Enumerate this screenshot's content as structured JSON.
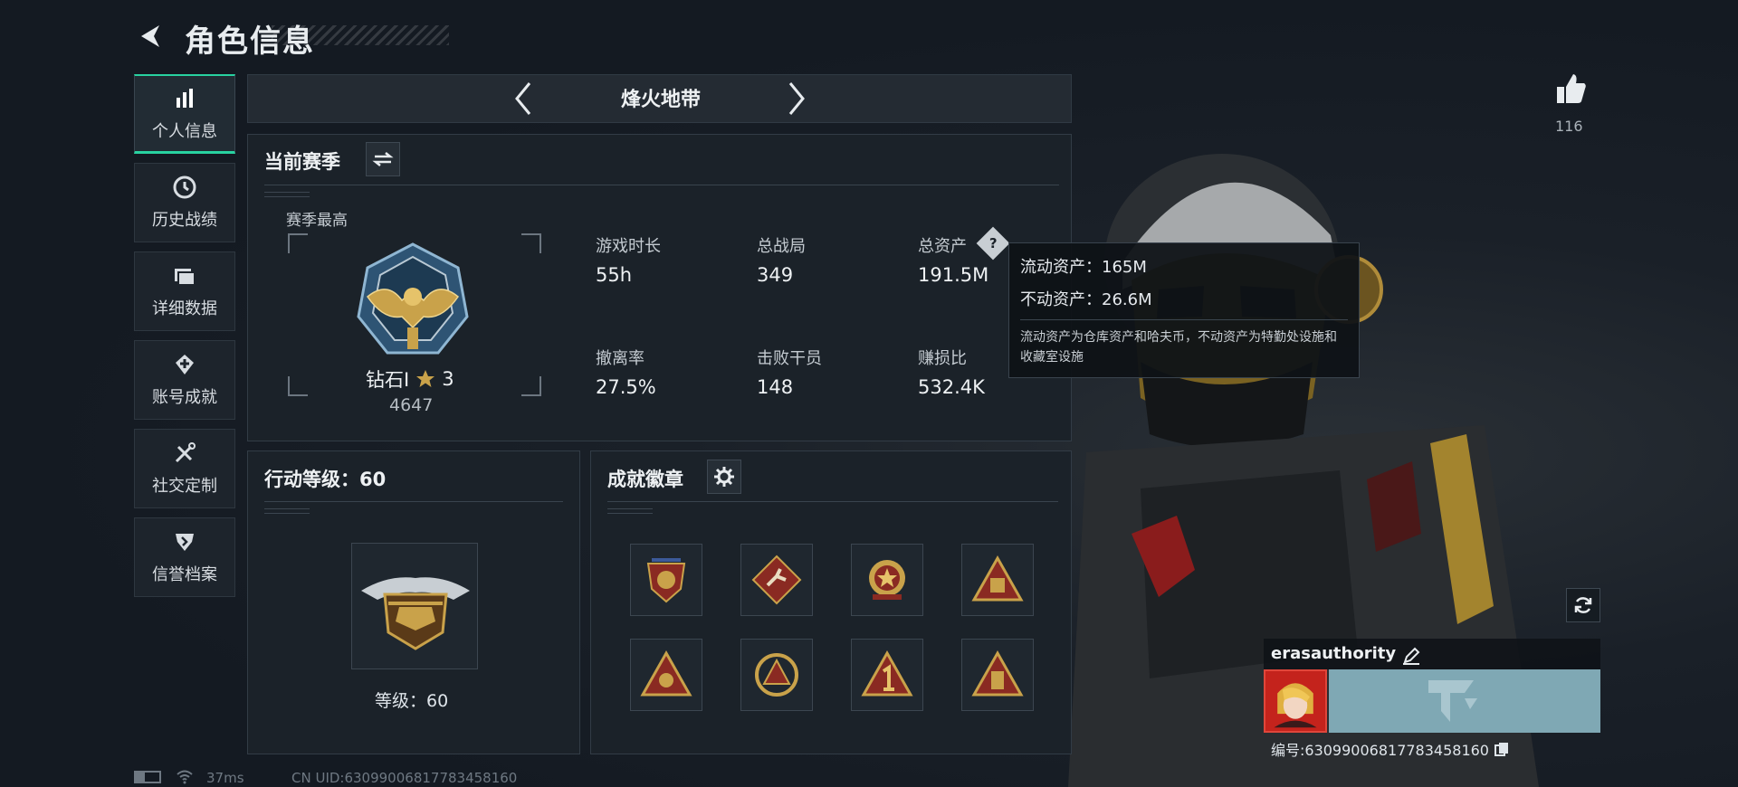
{
  "header": {
    "title": "角色信息"
  },
  "sidebar": {
    "items": [
      {
        "label": "个人信息",
        "icon": "bar-chart-icon"
      },
      {
        "label": "历史战绩",
        "icon": "clock-icon"
      },
      {
        "label": "详细数据",
        "icon": "folders-icon"
      },
      {
        "label": "账号成就",
        "icon": "achievement-icon"
      },
      {
        "label": "社交定制",
        "icon": "tools-icon"
      },
      {
        "label": "信誉档案",
        "icon": "shield-icon"
      }
    ]
  },
  "mode": {
    "title": "烽火地带"
  },
  "season": {
    "heading": "当前赛季",
    "best_label": "赛季最高",
    "rank_name": "钻石Ⅰ",
    "rank_stars": "3",
    "rank_points": "4647",
    "stats": [
      {
        "label": "游戏时长",
        "value": "55h"
      },
      {
        "label": "总战局",
        "value": "349"
      },
      {
        "label": "总资产",
        "value": "191.5M"
      },
      {
        "label": "撤离率",
        "value": "27.5%"
      },
      {
        "label": "击败干员",
        "value": "148"
      },
      {
        "label": "赚损比",
        "value": "532.4K"
      }
    ]
  },
  "tooltip": {
    "liquid": "流动资产：165M",
    "fixed": "不动资产：26.6M",
    "note": "流动资产为仓库资产和哈夫币，不动资产为特勤处设施和收藏室设施"
  },
  "action_level": {
    "heading": "行动等级：60",
    "level_text": "等级：60"
  },
  "badges": {
    "heading": "成就徽章"
  },
  "likes": {
    "count": "116"
  },
  "player": {
    "name": "erasauthority",
    "id_text": "编号:630990068177834581​60"
  },
  "status_bar": {
    "ping": "37ms",
    "uid": "CN UID:630990068177834581​60"
  },
  "colors": {
    "accent": "#28d2a0",
    "gold": "#c9a24a",
    "badge_red": "#8a2a22"
  }
}
